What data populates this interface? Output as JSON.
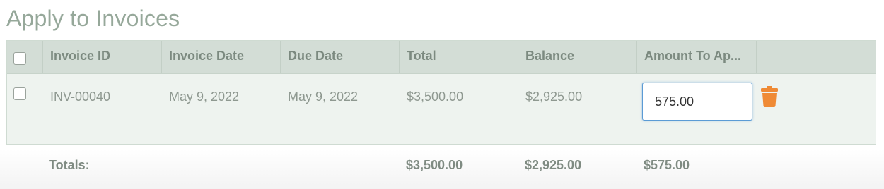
{
  "page": {
    "title": "Apply to Invoices"
  },
  "table": {
    "headers": {
      "invoice_id": "Invoice ID",
      "invoice_date": "Invoice Date",
      "due_date": "Due Date",
      "total": "Total",
      "balance": "Balance",
      "amount_to_apply": "Amount To Ap..."
    },
    "rows": [
      {
        "invoice_id": "INV-00040",
        "invoice_date": "May 9, 2022",
        "due_date": "May 9, 2022",
        "total": "$3,500.00",
        "balance": "$2,925.00",
        "amount_to_apply": "575.00",
        "selected": false
      }
    ]
  },
  "totals": {
    "label": "Totals:",
    "total": "$3,500.00",
    "balance": "$2,925.00",
    "amount_to_apply": "$575.00"
  },
  "colors": {
    "title": "#96a89a",
    "header_bg": "#d3ddd6",
    "row_bg": "#eef3ef",
    "input_focus_border": "#5b9bd5",
    "trash_icon": "#ef8a35"
  },
  "icons": {
    "delete": "trash-icon"
  }
}
